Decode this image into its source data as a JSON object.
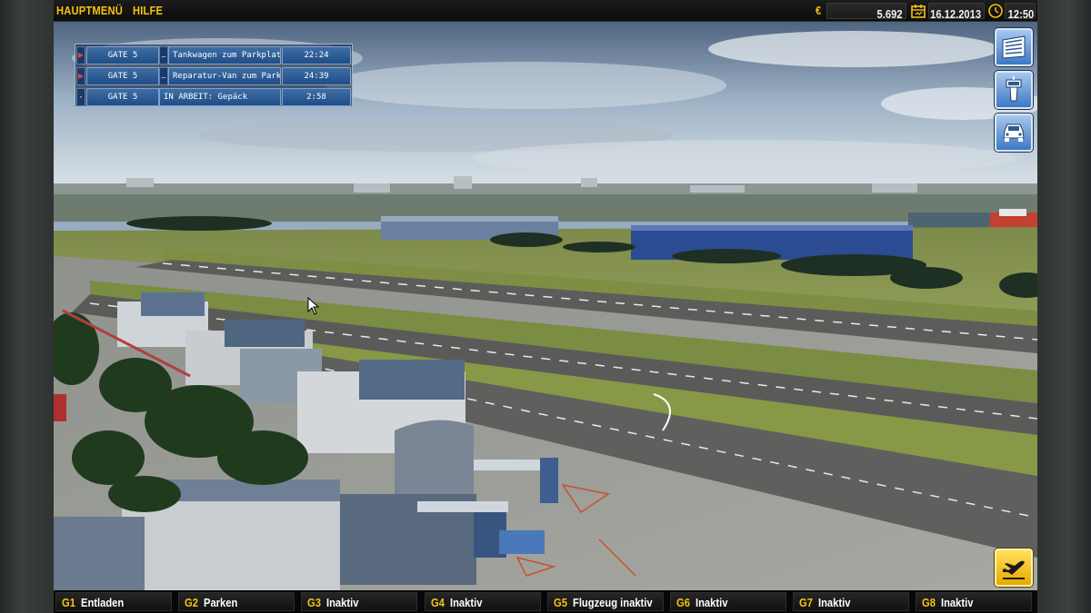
{
  "topbar": {
    "main_menu": "HAUPTMENÜ",
    "help": "HILFE",
    "currency_symbol": "€",
    "money": "5.692",
    "date": "16.12.2013",
    "time": "12:50",
    "calendar_icon": "calendar-icon",
    "clock_icon": "clock-icon",
    "accent_color": "#f4c40d"
  },
  "notifications": [
    {
      "gate": "GATE 5",
      "task": "Tankwagen zum Parkplatz",
      "time": "22:24"
    },
    {
      "gate": "GATE 5",
      "task": "Reparatur-Van zum Parkplatz",
      "time": "24:39"
    },
    {
      "gate": "GATE 5",
      "task": "IN ARBEIT: Gepäck",
      "time": "2:58"
    }
  ],
  "side_buttons": [
    {
      "icon": "departures-board-icon"
    },
    {
      "icon": "control-tower-icon"
    },
    {
      "icon": "vehicle-icon"
    }
  ],
  "action_button": {
    "icon": "airplane-takeoff-icon"
  },
  "gates": [
    {
      "id": "G1",
      "status": "Entladen"
    },
    {
      "id": "G2",
      "status": "Parken"
    },
    {
      "id": "G3",
      "status": "Inaktiv"
    },
    {
      "id": "G4",
      "status": "Inaktiv"
    },
    {
      "id": "G5",
      "status": "Flugzeug inaktiv"
    },
    {
      "id": "G6",
      "status": "Inaktiv"
    },
    {
      "id": "G7",
      "status": "Inaktiv"
    },
    {
      "id": "G8",
      "status": "Inaktiv"
    }
  ]
}
